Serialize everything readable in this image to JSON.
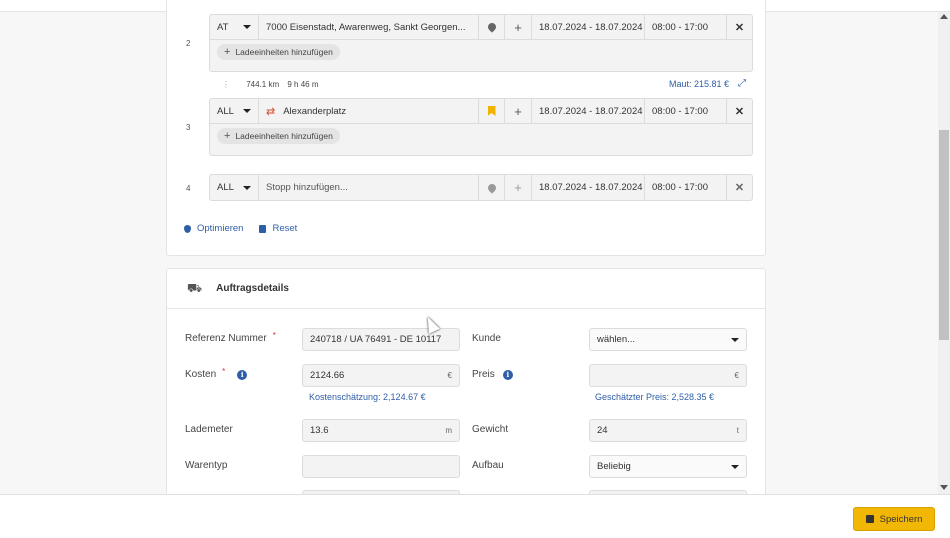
{
  "stops": [
    {
      "number": "2",
      "country": "AT",
      "address": "7000 Eisenstadt, Awarenweg, Sankt Georgen...",
      "icon": "map-pin-icon",
      "date": "18.07.2024 - 18.07.2024",
      "time": "08:00 - 17:00",
      "add_unit_label": "Ladeeinheiten hinzufügen"
    },
    {
      "number": "3",
      "country": "ALL",
      "address": "Alexanderplatz",
      "icon": "bookmark-icon",
      "date": "18.07.2024 - 18.07.2024",
      "time": "08:00 - 17:00",
      "add_unit_label": "Ladeeinheiten hinzufügen"
    },
    {
      "number": "4",
      "country": "ALL",
      "address_placeholder": "Stopp hinzufügen...",
      "icon": "map-pin-icon",
      "date": "18.07.2024 - 18.07.2024",
      "time": "08:00 - 17:00"
    }
  ],
  "segment": {
    "distance": "744.1 km",
    "duration": "9 h 46 m",
    "toll": "Maut: 215.81 €"
  },
  "actions": {
    "optimize": "Optimieren",
    "reset": "Reset"
  },
  "order": {
    "title": "Auftragsdetails",
    "reference_label": "Referenz Nummer",
    "reference_value": "240718 / UA 76491 - DE 10117",
    "customer_label": "Kunde",
    "customer_value": "wählen...",
    "costs_label": "Kosten",
    "costs_value": "2124.66",
    "costs_unit": "€",
    "costs_hint": "Kostenschätzung: 2,124.67 €",
    "price_label": "Preis",
    "price_value": "",
    "price_unit": "€",
    "price_hint": "Geschätzter Preis: 2,528.35 €",
    "lademeter_label": "Lademeter",
    "lademeter_value": "13.6",
    "lademeter_unit": "m",
    "weight_label": "Gewicht",
    "weight_value": "24",
    "weight_unit": "t",
    "goods_label": "Warentyp",
    "goods_value": "",
    "body_label": "Aufbau",
    "body_value": "Beliebig",
    "required_mark": "*"
  },
  "footer": {
    "save_label": "Speichern"
  },
  "colors": {
    "accent": "#2f5ea8",
    "save": "#f2b705",
    "swap": "#d64b2b"
  }
}
